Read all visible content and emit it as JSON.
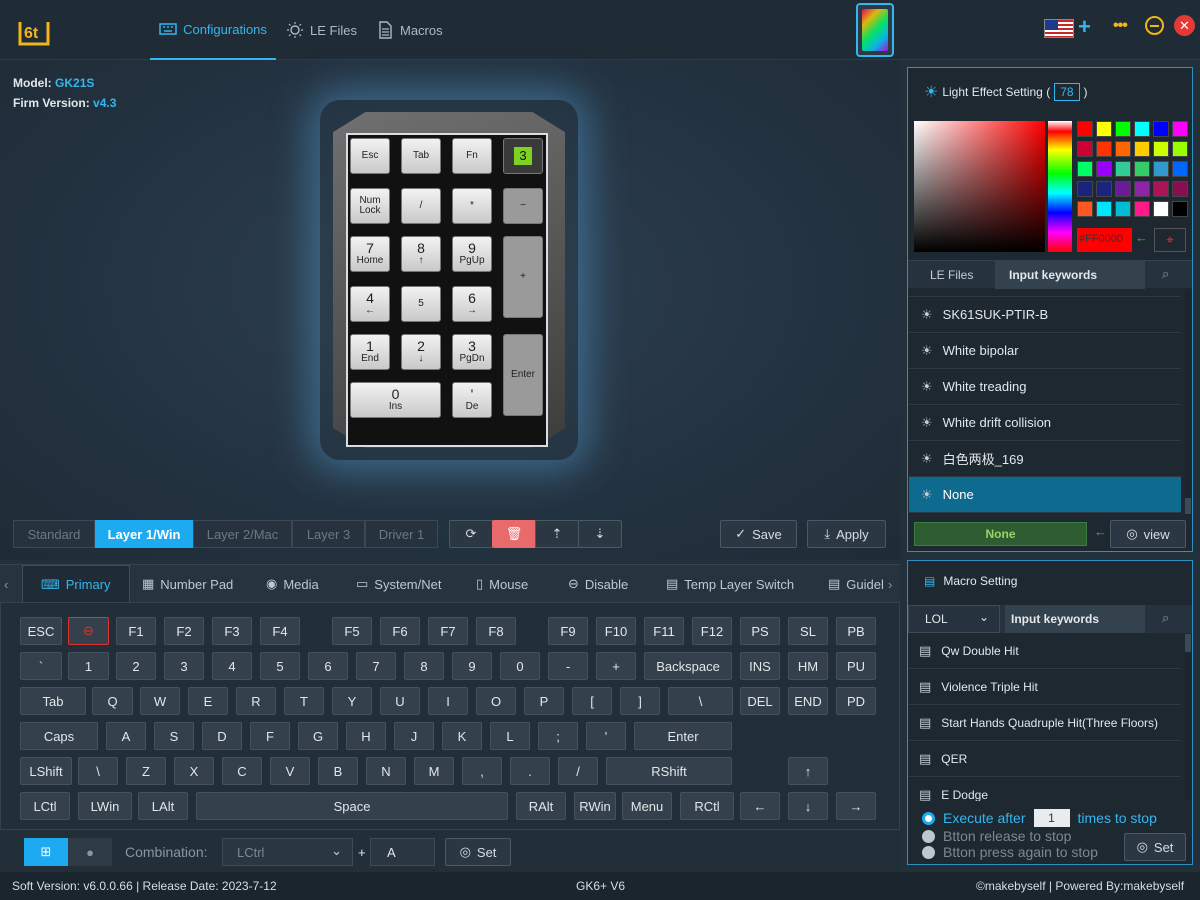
{
  "header": {
    "nav": [
      {
        "label": "Configurations",
        "icon": "keyboard-icon"
      },
      {
        "label": "LE Files",
        "icon": "bulb-icon"
      },
      {
        "label": "Macros",
        "icon": "document-icon"
      }
    ],
    "plus": "+",
    "more": "•••"
  },
  "device": {
    "model_label": "Model:",
    "model": "GK21S",
    "firm_label": "Firm Version:",
    "firm": "v4.3"
  },
  "numpad": {
    "keys": [
      {
        "t": "Esc"
      },
      {
        "t": "Tab"
      },
      {
        "t": "Fn"
      },
      {
        "t": "3"
      },
      {
        "t": "Num Lock"
      },
      {
        "t": "/"
      },
      {
        "t": "*"
      },
      {
        "t": "−"
      },
      {
        "t": "7",
        "s": "Home"
      },
      {
        "t": "8",
        "s": "↑"
      },
      {
        "t": "9",
        "s": "PgUp"
      },
      {
        "t": "+"
      },
      {
        "t": "4",
        "s": "←"
      },
      {
        "t": "5"
      },
      {
        "t": "6",
        "s": "→"
      },
      {
        "t": "1",
        "s": "End"
      },
      {
        "t": "2",
        "s": "↓"
      },
      {
        "t": "3",
        "s": "PgDn"
      },
      {
        "t": "Enter"
      },
      {
        "t": "0",
        "s": "Ins"
      },
      {
        "t": "'",
        "s": "De"
      }
    ]
  },
  "layers": [
    "Standard",
    "Layer 1/Win",
    "Layer 2/Mac",
    "Layer 3",
    "Driver 1"
  ],
  "actions": {
    "save": "Save",
    "apply": "Apply"
  },
  "tabs": [
    {
      "label": "Primary",
      "icon": "keyboard-icon"
    },
    {
      "label": "Number Pad",
      "icon": "calculator-icon"
    },
    {
      "label": "Media",
      "icon": "play-icon"
    },
    {
      "label": "System/Net",
      "icon": "monitor-icon"
    },
    {
      "label": "Mouse",
      "icon": "mouse-icon"
    },
    {
      "label": "Disable",
      "icon": "minus-circle-icon"
    },
    {
      "label": "Temp Layer Switch",
      "icon": "document-icon"
    },
    {
      "label": "Guidel",
      "icon": "document-icon"
    }
  ],
  "keyboard": {
    "rows": [
      [
        "ESC",
        "⊖",
        "F1",
        "F2",
        "F3",
        "F4",
        "F5",
        "F6",
        "F7",
        "F8",
        "F9",
        "F10",
        "F11",
        "F12",
        "PS",
        "SL",
        "PB"
      ],
      [
        "`",
        "1",
        "2",
        "3",
        "4",
        "5",
        "6",
        "7",
        "8",
        "9",
        "0",
        "-",
        "+",
        "Backspace",
        "INS",
        "HM",
        "PU"
      ],
      [
        "Tab",
        "Q",
        "W",
        "E",
        "R",
        "T",
        "Y",
        "U",
        "I",
        "O",
        "P",
        "[",
        "]",
        "\\",
        "DEL",
        "END",
        "PD"
      ],
      [
        "Caps",
        "A",
        "S",
        "D",
        "F",
        "G",
        "H",
        "J",
        "K",
        "L",
        ";",
        "'",
        "Enter"
      ],
      [
        "LShift",
        "\\",
        "Z",
        "X",
        "C",
        "V",
        "B",
        "N",
        "M",
        ",",
        ".",
        "/",
        "RShift",
        "↑"
      ],
      [
        "LCtl",
        "LWin",
        "LAlt",
        "Space",
        "RAlt",
        "RWin",
        "Menu",
        "RCtl",
        "←",
        "↓",
        "→"
      ]
    ]
  },
  "bottom": {
    "combination_label": "Combination:",
    "combination_value": "LCtrl",
    "plus": "+",
    "key_value": "A",
    "set": "Set"
  },
  "light": {
    "title": "Light Effect Setting (",
    "brightness": "78",
    "title_end": ")",
    "hex": "#FF0000",
    "tab_files": "LE Files",
    "search_placeholder": "Input keywords",
    "items": [
      "SK61SUK-PTIR-B",
      "White bipolar",
      "White treading",
      "White drift collision",
      "白色两极_169",
      "None"
    ],
    "selected": "None",
    "view": "view",
    "swatches": [
      "#ff0000",
      "#ffff00",
      "#00ff00",
      "#00ffff",
      "#0000ff",
      "#ff00ff",
      "#cc0033",
      "#ff3300",
      "#ff6600",
      "#ffcc00",
      "#ccff00",
      "#99ff00",
      "#00ff66",
      "#9900ff",
      "#33cc99",
      "#33cc66",
      "#3399cc",
      "#0066ff",
      "#1a237e",
      "#1a237e",
      "#6a1b9a",
      "#8e24aa",
      "#ad1457",
      "#880e4f",
      "#ff5722",
      "#00e5ff",
      "#00bcd4",
      "#ff1a8c",
      "#ffffff",
      "#000000"
    ]
  },
  "macro": {
    "title": "Macro Setting",
    "dropdown": "LOL",
    "search_placeholder": "Input keywords",
    "items": [
      "Qw Double Hit",
      "Violence Triple Hit",
      "Start Hands Quadruple Hit(Three Floors)",
      "QER",
      "E Dodge"
    ],
    "execute_before": "Execute after",
    "execute_count": "1",
    "execute_after": "times to stop",
    "opt2": "Btton release to stop",
    "opt3": "Btton press again to stop",
    "set": "Set"
  },
  "status": {
    "left": "Soft Version: v6.0.0.66 | Release Date: 2023-7-12",
    "center": "GK6+ V6",
    "right": "©makebyself | Powered By:makebyself"
  }
}
